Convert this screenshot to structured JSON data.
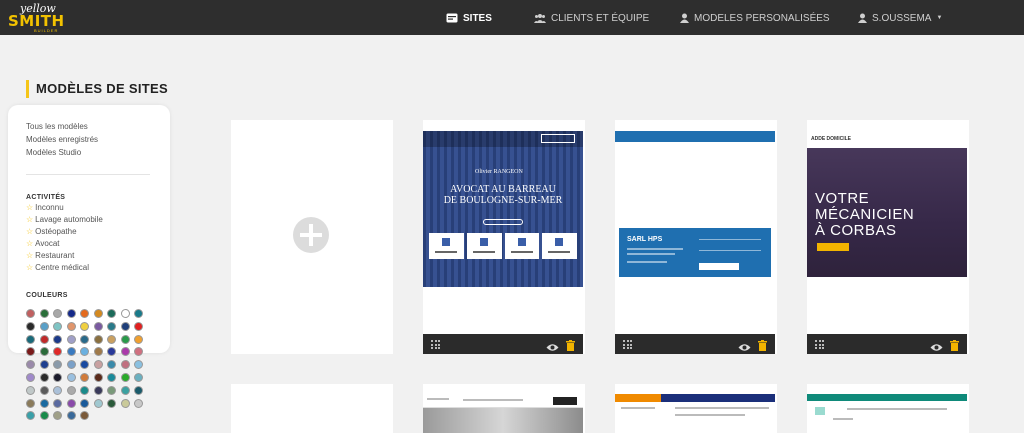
{
  "brand": {
    "logo_top": "yellow",
    "logo_main": "SMITH",
    "logo_sub": "BUILDER"
  },
  "nav": {
    "sites": "SITES",
    "clients": "CLIENTS ET ÉQUIPE",
    "models": "MODELES PERSONALISÉES",
    "user": "S.OUSSEMA"
  },
  "page": {
    "title": "MODÈLES DE SITES"
  },
  "sidebar": {
    "links": [
      "Tous les modèles",
      "Modèles enregistrés",
      "Modèles Studio"
    ],
    "activities_title": "ACTIVITÉS",
    "activities": [
      "Inconnu",
      "Lavage automobile",
      "Ostéopathe",
      "Avocat",
      "Restaurant",
      "Centre médical"
    ],
    "colors_title": "COULEURS",
    "colors": [
      "#c06060",
      "#2a6f3a",
      "#a8a8a8",
      "#152a8a",
      "#e46b1f",
      "#d48a20",
      "#1c6b5a",
      "#ffffff",
      "#197a8a",
      "#2a2a2a",
      "#5aa0c8",
      "#7fc4c4",
      "#e0956c",
      "#f0d040",
      "#7a5aa0",
      "#2a7a8a",
      "#1f3f7a",
      "#e02020",
      "#1a6a7a",
      "#c02a2a",
      "#1c3a8a",
      "#a0a0c8",
      "#2a6a8a",
      "#8a7040",
      "#caa060",
      "#2a9a4a",
      "#f0a030",
      "#7a1a1a",
      "#2a6a3a",
      "#e02a2a",
      "#3a7ac0",
      "#6ab0e0",
      "#a07a4a",
      "#2a3a9a",
      "#aa3aaa",
      "#d07080",
      "#9a8aaa",
      "#1f3f8f",
      "#8a9aaa",
      "#7aa0c8",
      "#1a4aa0",
      "#c8a0a0",
      "#3a8aaa",
      "#c07080",
      "#8ac0e0",
      "#a08aca",
      "#2a2a2a",
      "#1a1a2a",
      "#9ac0e0",
      "#d07a3a",
      "#5a2a1a",
      "#1a8a9a",
      "#2aaa2a",
      "#6ab0c0",
      "#c0c8c8",
      "#5a5a5a",
      "#aac0d8",
      "#aaaaaa",
      "#1a8a8a",
      "#3a3a5a",
      "#7a9a7a",
      "#3aa0a0",
      "#1a5a6a",
      "#8a7a5a",
      "#1a6aa0",
      "#5a6aa0",
      "#8a4aaa",
      "#1a5a9a",
      "#a0c8d0",
      "#2a5a3a",
      "#caca9a",
      "#c8c8c8",
      "#3aa0a8",
      "#1a8a4a",
      "#a0a088",
      "#3a6a9a",
      "#7a5a3a"
    ]
  },
  "cards": [
    {
      "logo": "Olivier RANGEON",
      "headline_1": "AVOCAT AU BARREAU",
      "headline_2": "DE BOULOGNE-SUR-MER"
    },
    {
      "company": "SARL HPS"
    },
    {
      "brand": "ADDE DOMICILE",
      "headline_1": "VOTRE",
      "headline_2": "MÉCANICIEN",
      "headline_3": "À CORBAS"
    }
  ]
}
